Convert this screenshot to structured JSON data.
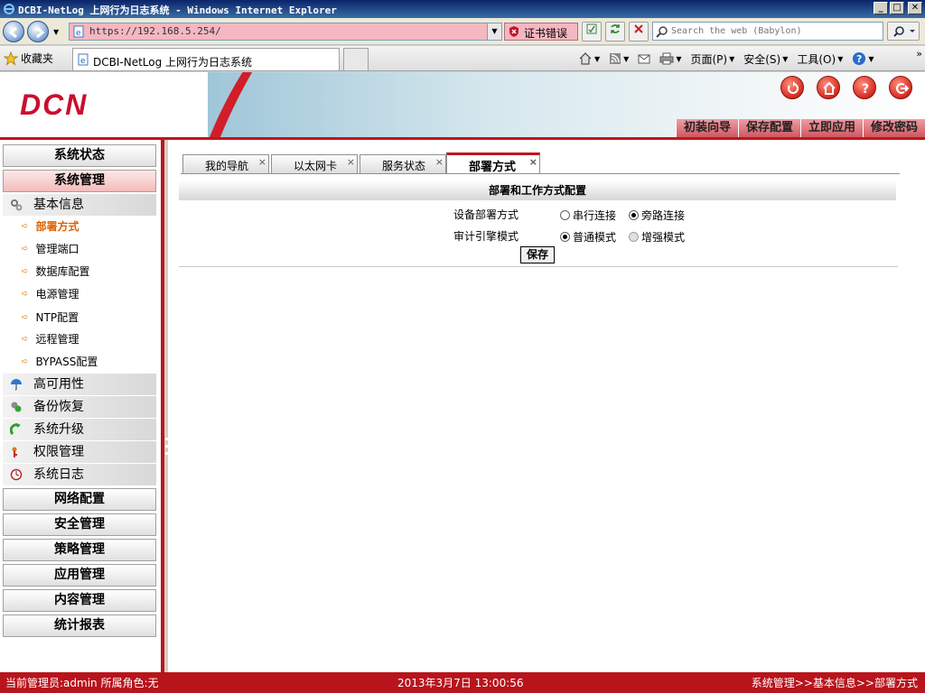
{
  "window": {
    "title": "DCBI-NetLog 上网行为日志系统 - Windows Internet Explorer",
    "buttons": {
      "minimize": "_",
      "maximize": "□",
      "close": "✕"
    }
  },
  "browser": {
    "address": "https://192.168.5.254/",
    "cert_error": "证书错误",
    "search_placeholder": "Search the web (Babylon)",
    "favorites": "收藏夹",
    "tab_title": "DCBI-NetLog 上网行为日志系统",
    "commands": {
      "page": "页面(P)",
      "safety": "安全(S)",
      "tools": "工具(O)"
    },
    "more": "»"
  },
  "header": {
    "logo": "DCN",
    "icons": [
      "refresh-icon",
      "home-icon",
      "help-icon",
      "logout-icon"
    ],
    "nav": [
      "初装向导",
      "保存配置",
      "立即应用",
      "修改密码"
    ]
  },
  "sidebar": {
    "sections": [
      {
        "label": "系统状态"
      },
      {
        "label": "系统管理"
      }
    ],
    "basic_info": "基本信息",
    "subitems": [
      "部署方式",
      "管理端口",
      "数据库配置",
      "电源管理",
      "NTP配置",
      "远程管理",
      "BYPASS配置"
    ],
    "items": [
      "高可用性",
      "备份恢复",
      "系统升级",
      "权限管理",
      "系统日志"
    ],
    "bottom_sections": [
      "网络配置",
      "安全管理",
      "策略管理",
      "应用管理",
      "内容管理",
      "统计报表"
    ]
  },
  "main": {
    "tabs": [
      "我的导航",
      "以太网卡",
      "服务状态",
      "部署方式"
    ],
    "tab_close": "×",
    "config_title": "部署和工作方式配置",
    "deploy_label": "设备部署方式",
    "deploy_options": [
      "串行连接",
      "旁路连接"
    ],
    "engine_label": "审计引擎模式",
    "engine_options": [
      "普通模式",
      "增强模式"
    ],
    "save_label": "保存"
  },
  "status": {
    "admin": "当前管理员:admin  所属角色:无",
    "datetime": "2013年3月7日 13:00:56",
    "breadcrumb": "系统管理>>基本信息>>部署方式"
  },
  "colors": {
    "brand_red": "#c0151e",
    "active_orange": "#e06000"
  }
}
